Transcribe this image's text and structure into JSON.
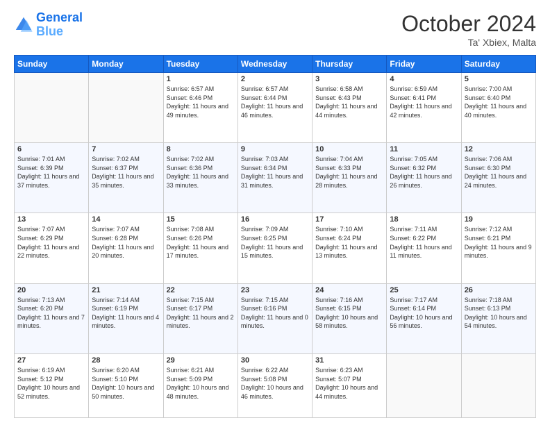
{
  "logo": {
    "line1": "General",
    "line2": "Blue"
  },
  "title": "October 2024",
  "subtitle": "Ta' Xbiex, Malta",
  "days_of_week": [
    "Sunday",
    "Monday",
    "Tuesday",
    "Wednesday",
    "Thursday",
    "Friday",
    "Saturday"
  ],
  "weeks": [
    [
      {
        "day": "",
        "detail": ""
      },
      {
        "day": "",
        "detail": ""
      },
      {
        "day": "1",
        "detail": "Sunrise: 6:57 AM\nSunset: 6:46 PM\nDaylight: 11 hours and 49 minutes."
      },
      {
        "day": "2",
        "detail": "Sunrise: 6:57 AM\nSunset: 6:44 PM\nDaylight: 11 hours and 46 minutes."
      },
      {
        "day": "3",
        "detail": "Sunrise: 6:58 AM\nSunset: 6:43 PM\nDaylight: 11 hours and 44 minutes."
      },
      {
        "day": "4",
        "detail": "Sunrise: 6:59 AM\nSunset: 6:41 PM\nDaylight: 11 hours and 42 minutes."
      },
      {
        "day": "5",
        "detail": "Sunrise: 7:00 AM\nSunset: 6:40 PM\nDaylight: 11 hours and 40 minutes."
      }
    ],
    [
      {
        "day": "6",
        "detail": "Sunrise: 7:01 AM\nSunset: 6:39 PM\nDaylight: 11 hours and 37 minutes."
      },
      {
        "day": "7",
        "detail": "Sunrise: 7:02 AM\nSunset: 6:37 PM\nDaylight: 11 hours and 35 minutes."
      },
      {
        "day": "8",
        "detail": "Sunrise: 7:02 AM\nSunset: 6:36 PM\nDaylight: 11 hours and 33 minutes."
      },
      {
        "day": "9",
        "detail": "Sunrise: 7:03 AM\nSunset: 6:34 PM\nDaylight: 11 hours and 31 minutes."
      },
      {
        "day": "10",
        "detail": "Sunrise: 7:04 AM\nSunset: 6:33 PM\nDaylight: 11 hours and 28 minutes."
      },
      {
        "day": "11",
        "detail": "Sunrise: 7:05 AM\nSunset: 6:32 PM\nDaylight: 11 hours and 26 minutes."
      },
      {
        "day": "12",
        "detail": "Sunrise: 7:06 AM\nSunset: 6:30 PM\nDaylight: 11 hours and 24 minutes."
      }
    ],
    [
      {
        "day": "13",
        "detail": "Sunrise: 7:07 AM\nSunset: 6:29 PM\nDaylight: 11 hours and 22 minutes."
      },
      {
        "day": "14",
        "detail": "Sunrise: 7:07 AM\nSunset: 6:28 PM\nDaylight: 11 hours and 20 minutes."
      },
      {
        "day": "15",
        "detail": "Sunrise: 7:08 AM\nSunset: 6:26 PM\nDaylight: 11 hours and 17 minutes."
      },
      {
        "day": "16",
        "detail": "Sunrise: 7:09 AM\nSunset: 6:25 PM\nDaylight: 11 hours and 15 minutes."
      },
      {
        "day": "17",
        "detail": "Sunrise: 7:10 AM\nSunset: 6:24 PM\nDaylight: 11 hours and 13 minutes."
      },
      {
        "day": "18",
        "detail": "Sunrise: 7:11 AM\nSunset: 6:22 PM\nDaylight: 11 hours and 11 minutes."
      },
      {
        "day": "19",
        "detail": "Sunrise: 7:12 AM\nSunset: 6:21 PM\nDaylight: 11 hours and 9 minutes."
      }
    ],
    [
      {
        "day": "20",
        "detail": "Sunrise: 7:13 AM\nSunset: 6:20 PM\nDaylight: 11 hours and 7 minutes."
      },
      {
        "day": "21",
        "detail": "Sunrise: 7:14 AM\nSunset: 6:19 PM\nDaylight: 11 hours and 4 minutes."
      },
      {
        "day": "22",
        "detail": "Sunrise: 7:15 AM\nSunset: 6:17 PM\nDaylight: 11 hours and 2 minutes."
      },
      {
        "day": "23",
        "detail": "Sunrise: 7:15 AM\nSunset: 6:16 PM\nDaylight: 11 hours and 0 minutes."
      },
      {
        "day": "24",
        "detail": "Sunrise: 7:16 AM\nSunset: 6:15 PM\nDaylight: 10 hours and 58 minutes."
      },
      {
        "day": "25",
        "detail": "Sunrise: 7:17 AM\nSunset: 6:14 PM\nDaylight: 10 hours and 56 minutes."
      },
      {
        "day": "26",
        "detail": "Sunrise: 7:18 AM\nSunset: 6:13 PM\nDaylight: 10 hours and 54 minutes."
      }
    ],
    [
      {
        "day": "27",
        "detail": "Sunrise: 6:19 AM\nSunset: 5:12 PM\nDaylight: 10 hours and 52 minutes."
      },
      {
        "day": "28",
        "detail": "Sunrise: 6:20 AM\nSunset: 5:10 PM\nDaylight: 10 hours and 50 minutes."
      },
      {
        "day": "29",
        "detail": "Sunrise: 6:21 AM\nSunset: 5:09 PM\nDaylight: 10 hours and 48 minutes."
      },
      {
        "day": "30",
        "detail": "Sunrise: 6:22 AM\nSunset: 5:08 PM\nDaylight: 10 hours and 46 minutes."
      },
      {
        "day": "31",
        "detail": "Sunrise: 6:23 AM\nSunset: 5:07 PM\nDaylight: 10 hours and 44 minutes."
      },
      {
        "day": "",
        "detail": ""
      },
      {
        "day": "",
        "detail": ""
      }
    ]
  ]
}
